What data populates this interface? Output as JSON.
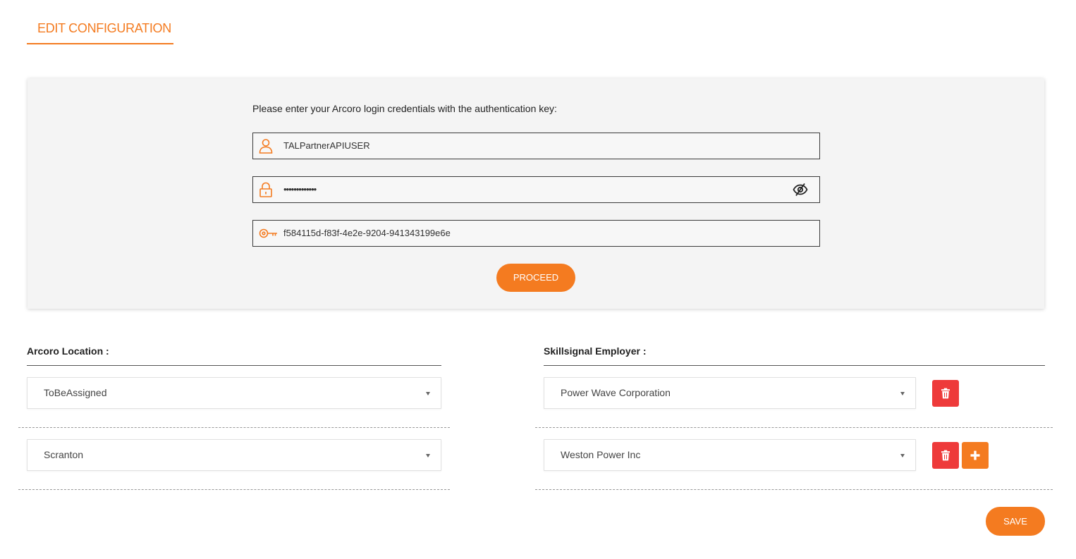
{
  "tab": {
    "label": "EDIT CONFIGURATION"
  },
  "credentials": {
    "prompt": "Please enter your Arcoro login credentials with the authentication key:",
    "username": "TALPartnerAPIUSER",
    "password_masked": "•••••••••••••",
    "auth_key": "f584115d-f83f-4e2e-9204-941343199e6e",
    "proceed_label": "PROCEED"
  },
  "mapping": {
    "left_header": "Arcoro Location :",
    "right_header": "Skillsignal Employer :",
    "rows": [
      {
        "location": "ToBeAssigned",
        "employer": "Power Wave Corporation"
      },
      {
        "location": "Scranton",
        "employer": "Weston Power Inc"
      }
    ]
  },
  "save_label": "SAVE",
  "colors": {
    "accent": "#f47b20",
    "danger": "#ee3a3a"
  },
  "icons": [
    "user-icon",
    "lock-icon",
    "eye-slash-icon",
    "key-icon",
    "caret-down-icon",
    "trash-icon",
    "plus-icon"
  ]
}
